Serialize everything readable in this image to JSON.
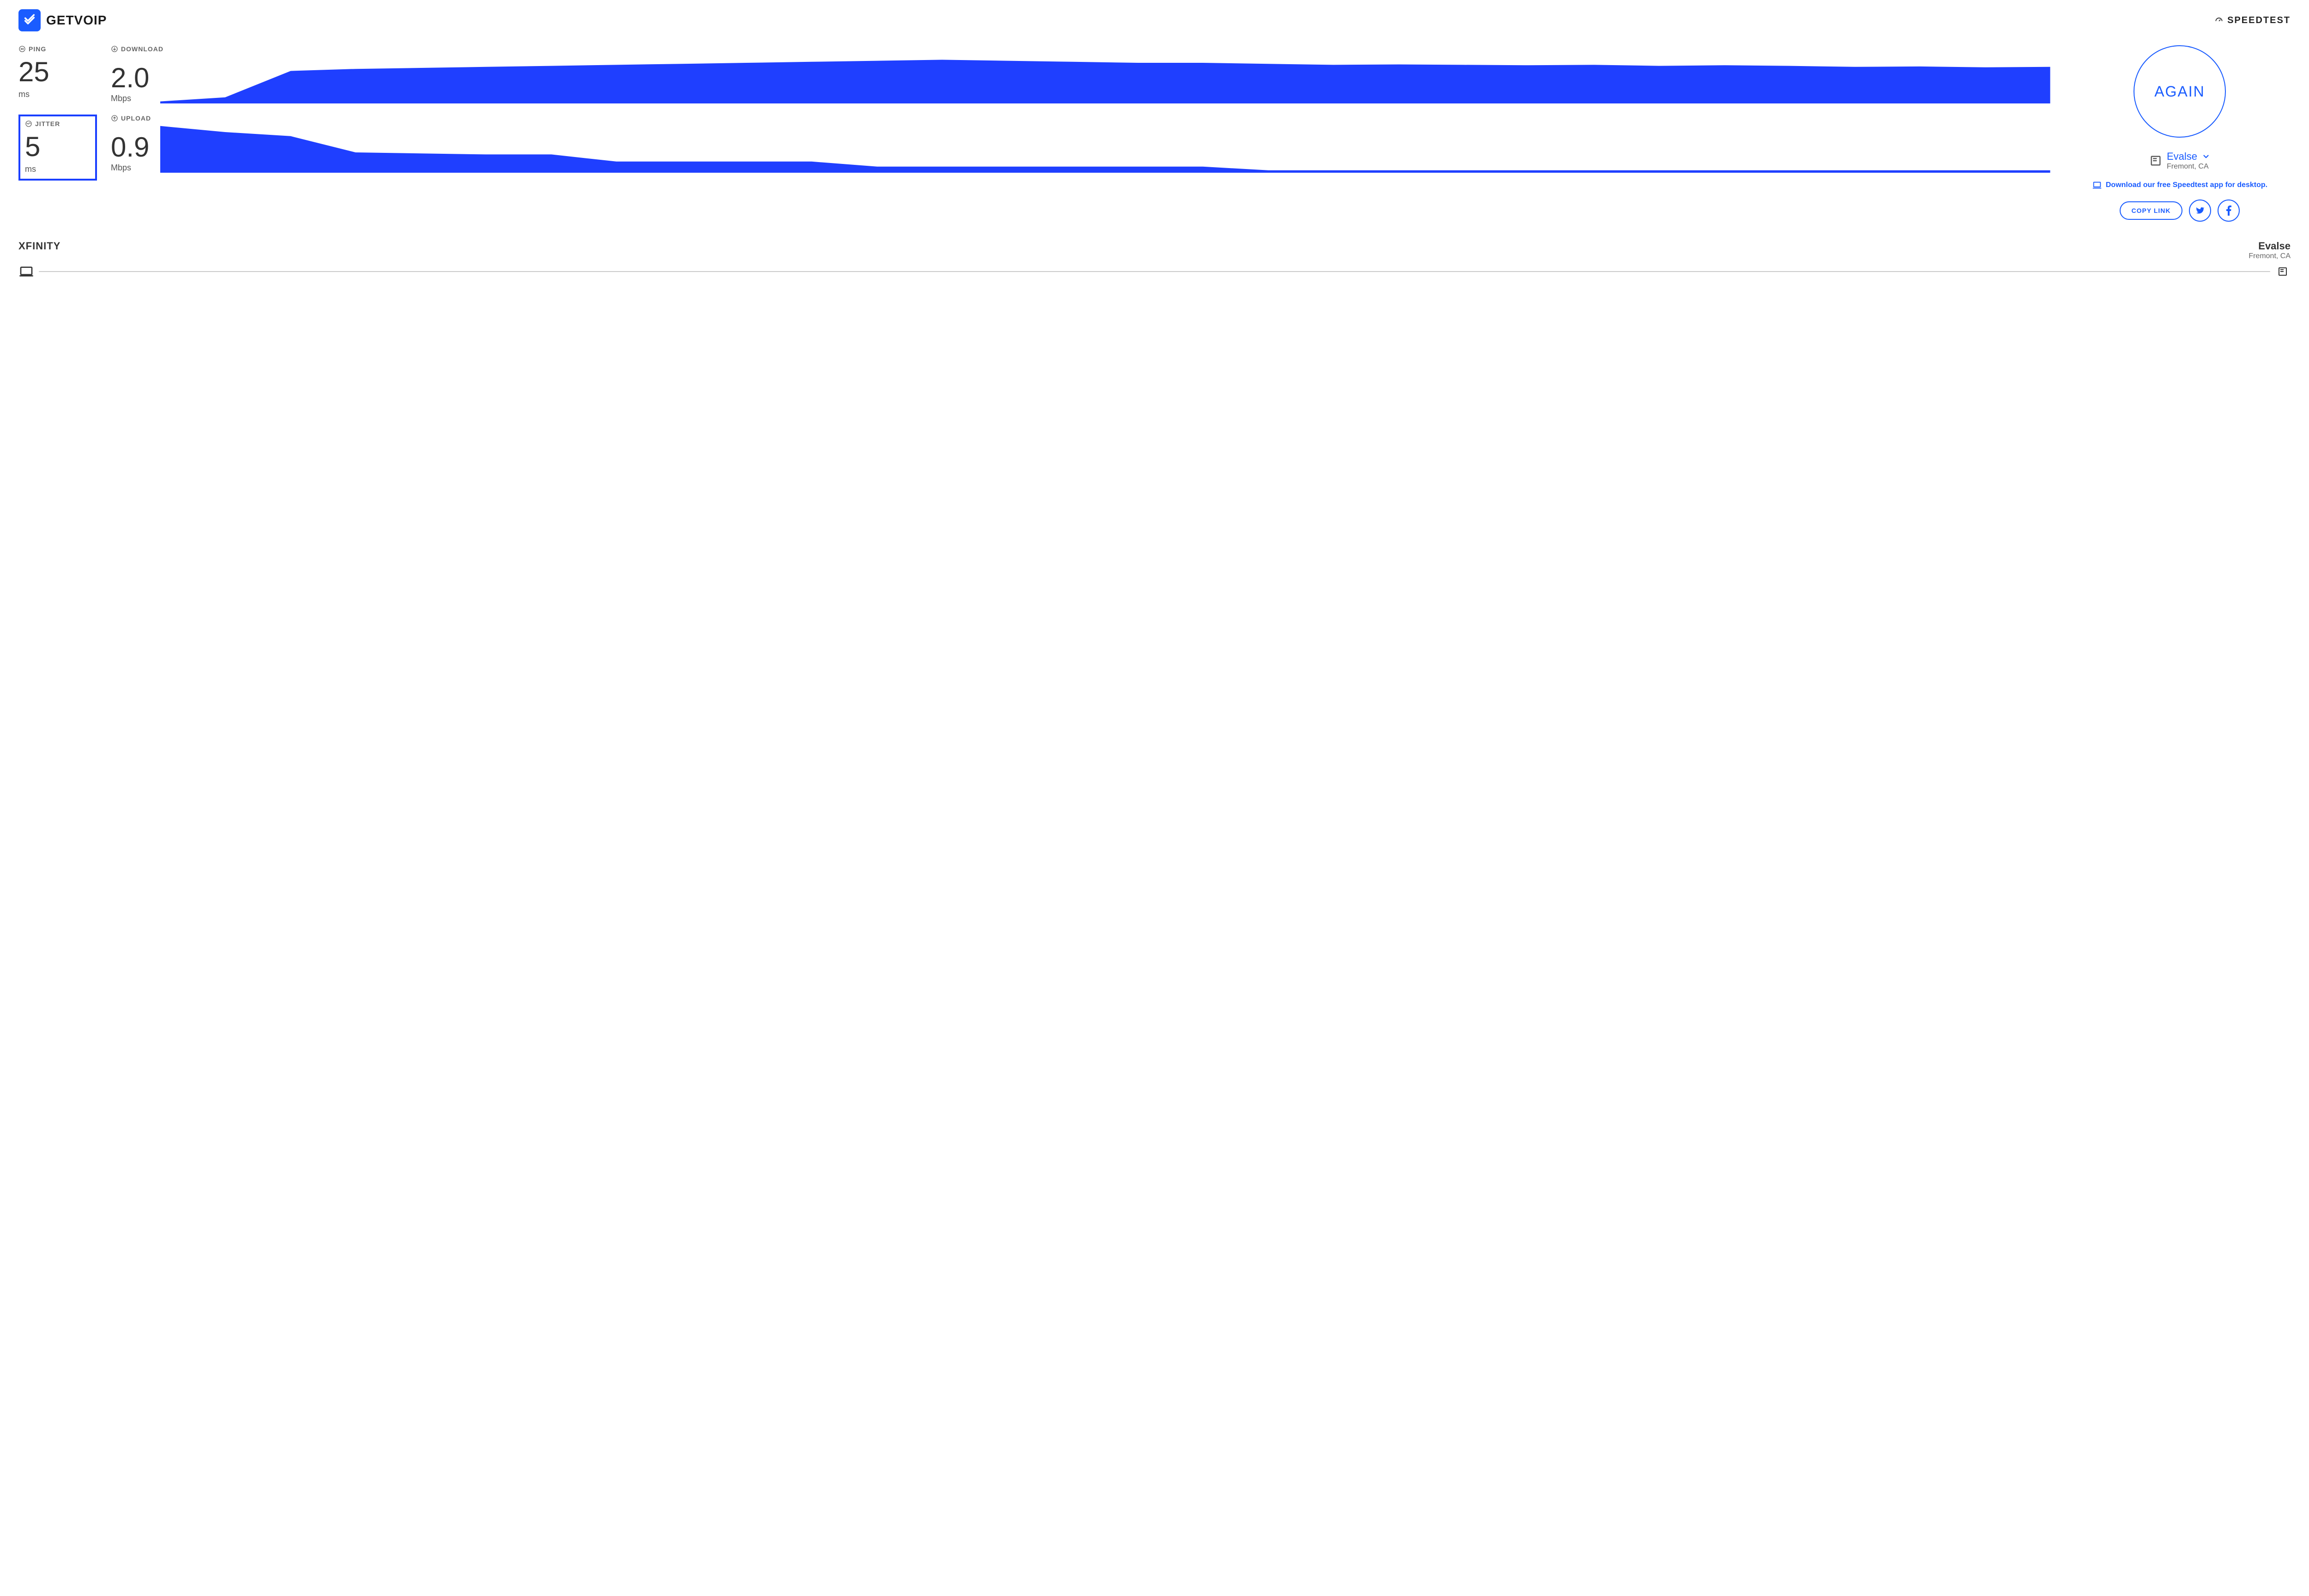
{
  "brand": {
    "name": "GETVOIP"
  },
  "speedtest": {
    "label": "SPEEDTEST"
  },
  "metrics": {
    "ping": {
      "label": "PING",
      "value": "25",
      "unit": "ms"
    },
    "jitter": {
      "label": "JITTER",
      "value": "5",
      "unit": "ms"
    },
    "download": {
      "label": "DOWNLOAD",
      "value": "2.0",
      "unit": "Mbps"
    },
    "upload": {
      "label": "UPLOAD",
      "value": "0.9",
      "unit": "Mbps"
    }
  },
  "again": {
    "label": "AGAIN"
  },
  "server": {
    "name": "Evalse",
    "location": "Fremont, CA"
  },
  "download_app": {
    "label": "Download our free Speedtest app for desktop."
  },
  "share": {
    "copy": "COPY LINK"
  },
  "footer": {
    "isp": "XFINITY",
    "server_name": "Evalse",
    "server_location": "Fremont, CA"
  },
  "colors": {
    "primary": "#1a5cff",
    "chart_fill": "#1f3fff"
  },
  "chart_data": [
    {
      "type": "area",
      "title": "Download",
      "ylabel": "Mbps",
      "xlim": [
        0,
        100
      ],
      "ylim": [
        0,
        2.5
      ],
      "values": [
        0.1,
        0.3,
        1.6,
        1.7,
        1.75,
        1.8,
        1.85,
        1.9,
        1.95,
        2.0,
        2.05,
        2.1,
        2.15,
        2.1,
        2.05,
        2.0,
        2.0,
        1.95,
        1.9,
        1.92,
        1.9,
        1.88,
        1.9,
        1.85,
        1.88,
        1.85,
        1.8,
        1.82,
        1.78,
        1.8
      ]
    },
    {
      "type": "area",
      "title": "Upload",
      "ylabel": "Mbps",
      "xlim": [
        0,
        100
      ],
      "ylim": [
        0,
        2.5
      ],
      "values": [
        2.3,
        2.0,
        1.8,
        1.0,
        0.95,
        0.9,
        0.9,
        0.55,
        0.55,
        0.55,
        0.55,
        0.3,
        0.3,
        0.3,
        0.3,
        0.3,
        0.3,
        0.12,
        0.12,
        0.12,
        0.12,
        0.12,
        0.12,
        0.12,
        0.12,
        0.12,
        0.12,
        0.12,
        0.12,
        0.12
      ]
    }
  ]
}
